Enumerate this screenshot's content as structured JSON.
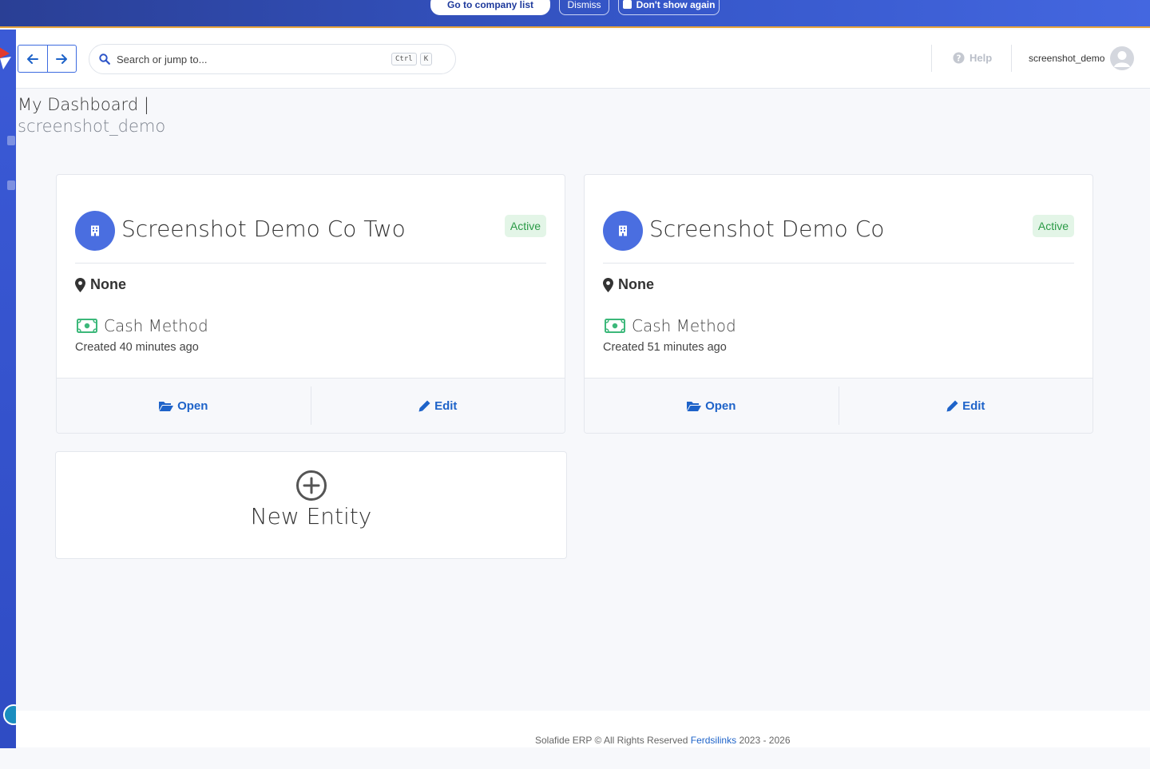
{
  "banner": {
    "go_to_company_label": "Go to company list",
    "dismiss_label": "Dismiss",
    "dont_show_label": "Don't show again"
  },
  "search": {
    "placeholder": "Search or jump to...",
    "shortcut_keys": [
      "Ctrl",
      "K"
    ]
  },
  "header": {
    "help_label": "Help",
    "username": "screenshot_demo"
  },
  "page": {
    "title": "My Dashboard |",
    "subtitle": "screenshot_demo"
  },
  "entities": [
    {
      "name": "Screenshot Demo Co Two",
      "status": "Active",
      "location": "None",
      "method": "Cash Method",
      "created": "Created 40 minutes ago",
      "open_label": "Open",
      "edit_label": "Edit"
    },
    {
      "name": "Screenshot Demo Co",
      "status": "Active",
      "location": "None",
      "method": "Cash Method",
      "created": "Created 51 minutes ago",
      "open_label": "Open",
      "edit_label": "Edit"
    }
  ],
  "new_entity_label": "New Entity",
  "footer": {
    "text_before": "Solafide ERP © All Rights Reserved",
    "link": "Ferdsilinks",
    "text_after": "2023 - 2026"
  },
  "colors": {
    "accent": "#3556c8",
    "link": "#1e63c9",
    "status_active": "#2a9a46",
    "money_icon": "#3cb87a"
  }
}
